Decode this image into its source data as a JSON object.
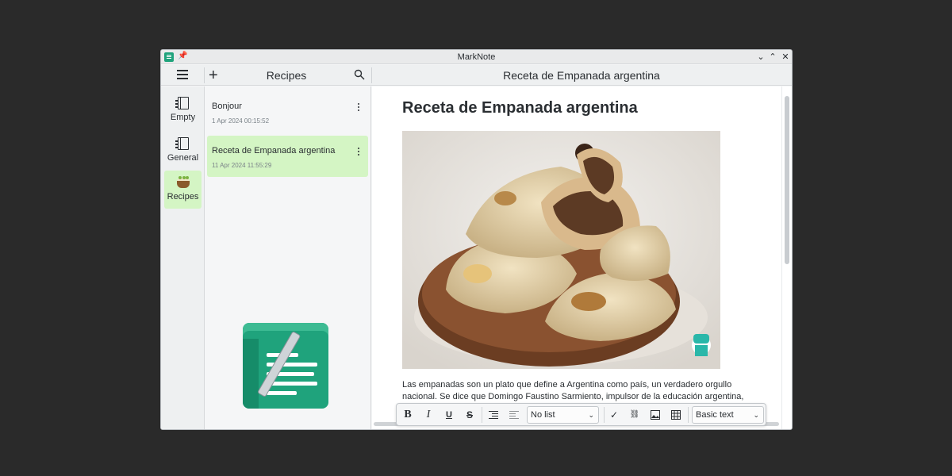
{
  "window": {
    "title": "MarkNote",
    "minimize": "⌄",
    "maximize": "⌃",
    "close": "✕"
  },
  "toolbar": {
    "notebook_title": "Recipes",
    "note_title": "Receta de Empanada argentina"
  },
  "sidebar": {
    "items": [
      {
        "label": "Empty",
        "icon": "notebook-icon"
      },
      {
        "label": "General",
        "icon": "notebook-icon"
      },
      {
        "label": "Recipes",
        "icon": "cake-icon"
      }
    ]
  },
  "notes": [
    {
      "title": "Bonjour",
      "date": "1 Apr 2024 00:15:52"
    },
    {
      "title": "Receta de Empanada argentina",
      "date": "11 Apr 2024 11:55:29"
    }
  ],
  "editor": {
    "heading": "Receta de Empanada argentina",
    "body": "Las empanadas son un plato que define a Argentina como país, un verdadero orgullo nacional. Se dice que Domingo Faustino Sarmiento, impulsor de la educación argentina, dijo"
  },
  "format_toolbar": {
    "bold": "B",
    "italic": "I",
    "underline": "U",
    "strike": "S",
    "list_style": "No list",
    "text_style": "Basic text"
  },
  "colors": {
    "accent_green": "#1fa37c",
    "selection_green": "#d4f5c4"
  }
}
